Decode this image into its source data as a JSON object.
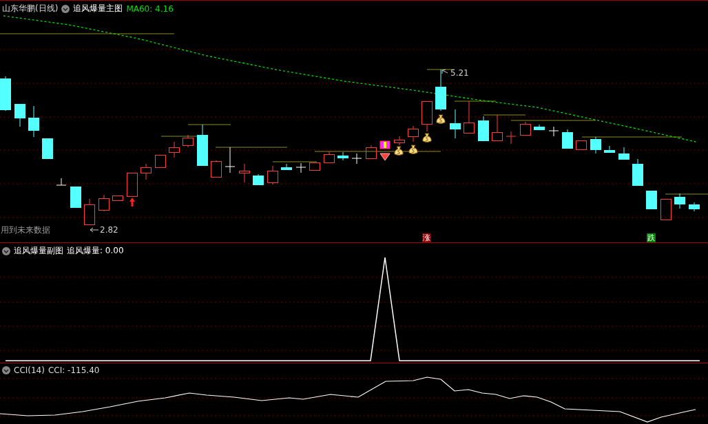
{
  "main_panel": {
    "stock_title": "山东华鹏(日线)",
    "indicator_name": "追风爆量主图",
    "ma_label": "MA60: 4.16",
    "high_label": "5.21",
    "low_label": "2.82",
    "future_data_note": "用到未来数据",
    "badges": [
      {
        "text": "涨",
        "kind": "rise"
      },
      {
        "text": "跌",
        "kind": "fall"
      }
    ]
  },
  "sub_panel": {
    "title": "追风爆量副图",
    "value_label": "追风爆量: 0.00"
  },
  "cci_panel": {
    "title": "CCI(14)",
    "value_label": "CCI: -115.40"
  }
}
